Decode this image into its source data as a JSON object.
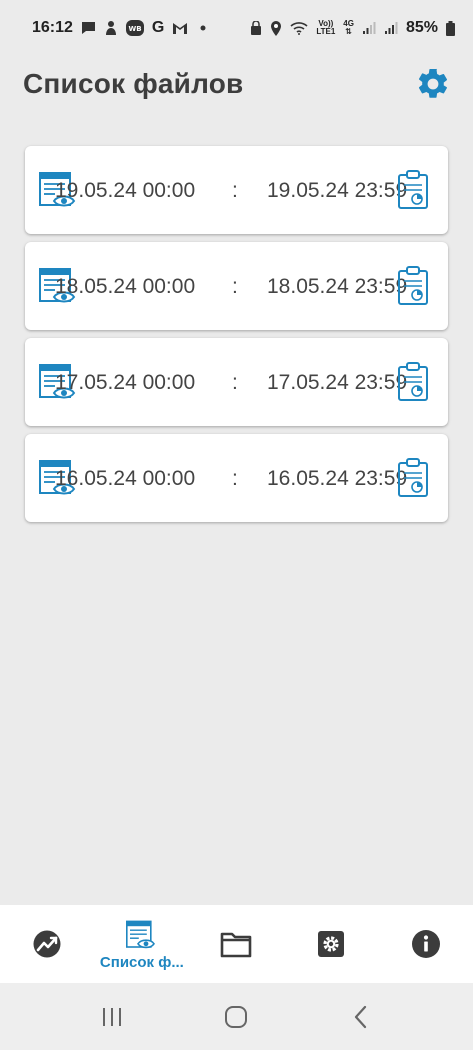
{
  "status_bar": {
    "time": "16:12",
    "wb_badge": "WB",
    "g_letter": "G",
    "volte_top": "Vo))",
    "volte_bottom": "LTE1",
    "net_top": "4G",
    "battery": "85%"
  },
  "header": {
    "title": "Список файлов"
  },
  "file_list": [
    {
      "start": "19.05.24 00:00",
      "separator": ":",
      "end": "19.05.24 23:59"
    },
    {
      "start": "18.05.24 00:00",
      "separator": ":",
      "end": "18.05.24 23:59"
    },
    {
      "start": "17.05.24 00:00",
      "separator": ":",
      "end": "17.05.24 23:59"
    },
    {
      "start": "16.05.24 00:00",
      "separator": ":",
      "end": "16.05.24 23:59"
    }
  ],
  "bottom_nav": {
    "active_label": "Список ф...",
    "items": [
      "chart-icon",
      "file-list-icon",
      "folder-icon",
      "settings-icon",
      "info-icon"
    ]
  },
  "colors": {
    "accent": "#1e86c0",
    "nav_icon": "#3c3c3c",
    "background": "#ebebeb"
  }
}
